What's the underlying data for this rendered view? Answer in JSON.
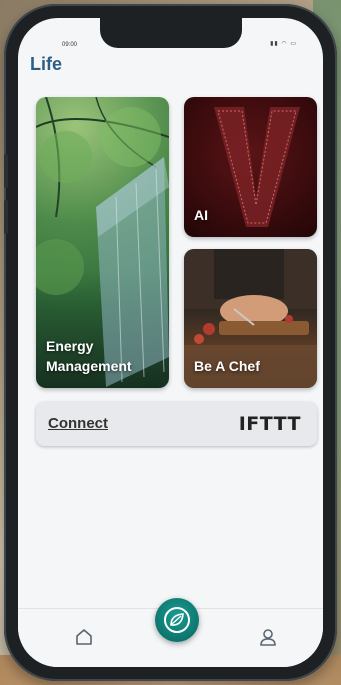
{
  "status_bar": {
    "time": "09:00",
    "icons": [
      "signal-icon",
      "wifi-icon",
      "battery-icon"
    ]
  },
  "header": {
    "title": "Life"
  },
  "cards": {
    "energy": {
      "label": "Energy Management"
    },
    "ai": {
      "label": "AI"
    },
    "chef": {
      "label": "Be A Chef"
    }
  },
  "connect": {
    "label": "Connect",
    "logo_text": "IFTTT"
  },
  "nav": {
    "items": [
      {
        "icon": "home-icon"
      },
      {
        "icon": "leaf-icon"
      },
      {
        "icon": "user-icon"
      }
    ]
  },
  "colors": {
    "title": "#2d5f86",
    "accent": "#0f8a80"
  }
}
